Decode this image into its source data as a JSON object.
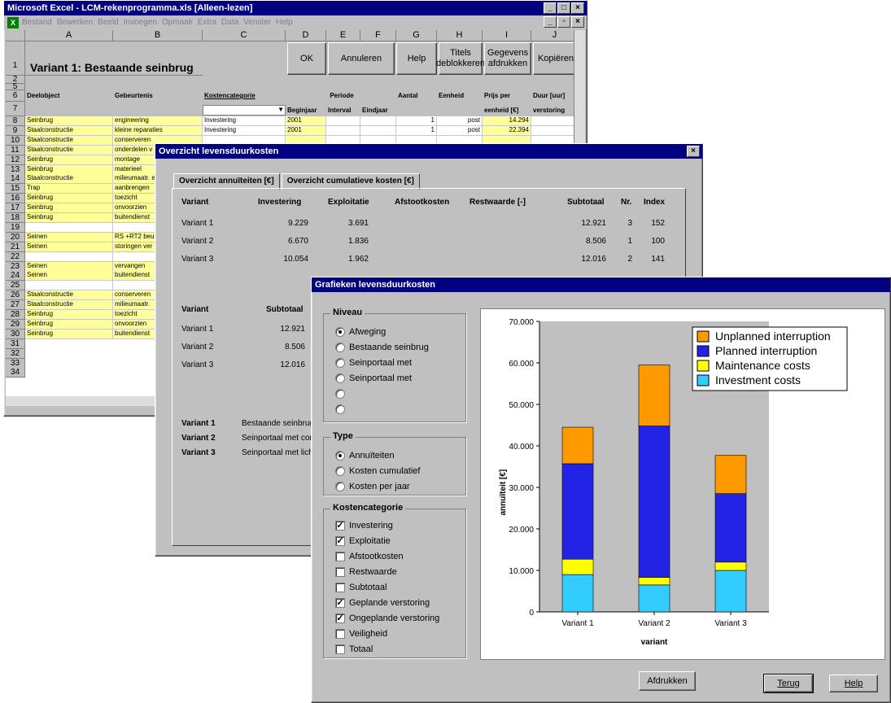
{
  "excel": {
    "title": "Microsoft Excel - LCM-rekenprogramma.xls  [Alleen-lezen]",
    "menu": [
      "Bestand",
      "Bewerken",
      "Beeld",
      "Invoegen",
      "Opmaak",
      "Extra",
      "Data",
      "Venster",
      "Help"
    ],
    "columns": [
      "A",
      "B",
      "C",
      "D",
      "E",
      "F",
      "G",
      "H",
      "I",
      "J"
    ],
    "heading": "Variant 1: Bestaande seinbrug",
    "buttons": {
      "ok": "OK",
      "cancel": "Annuleren",
      "help": "Help",
      "unlock_line1": "Titels",
      "unlock_line2": "deblokkeren",
      "print_line1": "Gegevens",
      "print_line2": "afdrukken",
      "copy": "Kopiëren"
    },
    "row_numbers": [
      "1",
      "2",
      "5",
      "6",
      "7",
      "8",
      "9",
      "10",
      "11",
      "12",
      "13",
      "14",
      "15",
      "16",
      "17",
      "18",
      "19",
      "20",
      "21",
      "22",
      "23",
      "24",
      "25",
      "26",
      "27",
      "28",
      "29",
      "30",
      "31",
      "32",
      "33",
      "34"
    ],
    "headers": {
      "deelobject": "Deelobject",
      "gebeurtenis": "Gebeurtenis",
      "kostencategorie": "Kostencategorie",
      "periode": "Periode",
      "beginjaar": "Beginjaar",
      "interval": "Interval",
      "eindjaar": "Eindjaar",
      "aantal": "Aantal",
      "eenheid": "Eenheid",
      "prijs_per": "Prijs per",
      "eenheid_eur": "eenheid [€]",
      "duur": "Duur [uur]",
      "verstoring": "verstoring"
    },
    "rows": [
      {
        "a": "Seinbrug",
        "b": "engineering",
        "c": "Investering",
        "d": "2001",
        "g": "1",
        "h": "post",
        "i": "14.294"
      },
      {
        "a": "Staalconstructie",
        "b": "kleine reparaties",
        "c": "Investering",
        "d": "2001",
        "g": "1",
        "h": "post",
        "i": "22.394"
      },
      {
        "a": "Staalconstructie",
        "b": "conserveren",
        "c": "",
        "d": "",
        "g": "",
        "h": "",
        "i": ""
      },
      {
        "a": "Staalconstructie",
        "b": "onderdelen v",
        "c": "",
        "d": "",
        "g": "",
        "h": "",
        "i": ""
      },
      {
        "a": "Seinbrug",
        "b": "montage",
        "c": "",
        "d": "",
        "g": "",
        "h": "",
        "i": ""
      },
      {
        "a": "Seinbrug",
        "b": "materieel",
        "c": "",
        "d": "",
        "g": "",
        "h": "",
        "i": ""
      },
      {
        "a": "Staalconstructie",
        "b": "milieumaatr. e",
        "c": "",
        "d": "",
        "g": "",
        "h": "",
        "i": ""
      },
      {
        "a": "Trap",
        "b": "aanbrengen",
        "c": "",
        "d": "",
        "g": "",
        "h": "",
        "i": ""
      },
      {
        "a": "Seinbrug",
        "b": "toezicht",
        "c": "",
        "d": "",
        "g": "",
        "h": "",
        "i": ""
      },
      {
        "a": "Seinbrug",
        "b": "onvoorzien",
        "c": "",
        "d": "",
        "g": "",
        "h": "",
        "i": ""
      },
      {
        "a": "Seinbrug",
        "b": "buitendienst",
        "c": "",
        "d": "",
        "g": "",
        "h": "",
        "i": ""
      },
      {
        "a": "",
        "b": "",
        "c": "",
        "d": "",
        "g": "",
        "h": "",
        "i": ""
      },
      {
        "a": "Seinen",
        "b": "RS +RT2 beu",
        "c": "",
        "d": "",
        "g": "",
        "h": "",
        "i": ""
      },
      {
        "a": "Seinen",
        "b": "storingen ver",
        "c": "",
        "d": "",
        "g": "",
        "h": "",
        "i": ""
      },
      {
        "a": "",
        "b": "",
        "c": "",
        "d": "",
        "g": "",
        "h": "",
        "i": ""
      },
      {
        "a": "Seinen",
        "b": "vervangen",
        "c": "",
        "d": "",
        "g": "",
        "h": "",
        "i": ""
      },
      {
        "a": "Seinen",
        "b": "buitendienst",
        "c": "",
        "d": "",
        "g": "",
        "h": "",
        "i": ""
      },
      {
        "a": "",
        "b": "",
        "c": "",
        "d": "",
        "g": "",
        "h": "",
        "i": ""
      },
      {
        "a": "Staalconstructie",
        "b": "conserveren",
        "c": "",
        "d": "",
        "g": "",
        "h": "",
        "i": ""
      },
      {
        "a": "Staalconstructie",
        "b": "milieumaatr.",
        "c": "",
        "d": "",
        "g": "",
        "h": "",
        "i": ""
      },
      {
        "a": "Seinbrug",
        "b": "toezicht",
        "c": "",
        "d": "",
        "g": "",
        "h": "",
        "i": ""
      },
      {
        "a": "Seinbrug",
        "b": "onvoorzien",
        "c": "",
        "d": "",
        "g": "",
        "h": "",
        "i": ""
      },
      {
        "a": "Seinbrug",
        "b": "buitendienst",
        "c": "",
        "d": "",
        "g": "",
        "h": "",
        "i": ""
      }
    ]
  },
  "overview": {
    "title": "Overzicht levensduurkosten",
    "tabs": [
      "Overzicht annuïteiten [€]",
      "Overzicht cumulatieve kosten [€]"
    ],
    "cols": [
      "Variant",
      "Investering",
      "Exploitatie",
      "Afstootkosten",
      "Restwaarde [-]",
      "Subtotaal",
      "Nr.",
      "Index"
    ],
    "rows": [
      {
        "variant": "Variant 1",
        "investering": "9.229",
        "exploitatie": "3.691",
        "subtotaal": "12.921",
        "nr": "3",
        "index": "152"
      },
      {
        "variant": "Variant 2",
        "investering": "6.670",
        "exploitatie": "1.836",
        "subtotaal": "8.506",
        "nr": "1",
        "index": "100"
      },
      {
        "variant": "Variant 3",
        "investering": "10.054",
        "exploitatie": "1.962",
        "subtotaal": "12.016",
        "nr": "2",
        "index": "141"
      }
    ],
    "cols2": [
      "Variant",
      "Subtotaal"
    ],
    "rows2": [
      {
        "variant": "Variant 1",
        "subtotaal": "12.921"
      },
      {
        "variant": "Variant 2",
        "subtotaal": "8.506"
      },
      {
        "variant": "Variant 3",
        "subtotaal": "12.016"
      }
    ],
    "legend": [
      {
        "variant": "Variant 1",
        "desc": "Bestaande seinbrug"
      },
      {
        "variant": "Variant 2",
        "desc": "Seinportaal met conv"
      },
      {
        "variant": "Variant 3",
        "desc": "Seinportaal met lichtg"
      }
    ]
  },
  "graph": {
    "title": "Grafieken levensduurkosten",
    "niveau_label": "Niveau",
    "niveau": [
      {
        "label": "Afweging",
        "on": true
      },
      {
        "label": "Bestaande seinbrug",
        "on": false
      },
      {
        "label": "Seinportaal met",
        "on": false
      },
      {
        "label": "Seinportaal met",
        "on": false
      },
      {
        "label": "",
        "on": false
      },
      {
        "label": "",
        "on": false
      }
    ],
    "type_label": "Type",
    "type": [
      {
        "label": "Annuïteiten",
        "on": true
      },
      {
        "label": "Kosten cumulatief",
        "on": false
      },
      {
        "label": "Kosten per jaar",
        "on": false
      }
    ],
    "kosten_label": "Kostencategorie",
    "kosten": [
      {
        "label": "Investering",
        "on": true
      },
      {
        "label": "Exploitatie",
        "on": true
      },
      {
        "label": "Afstootkosten",
        "on": false
      },
      {
        "label": "Restwaarde",
        "on": false
      },
      {
        "label": "Subtotaal",
        "on": false
      },
      {
        "label": "Geplande verstoring",
        "on": true
      },
      {
        "label": "Ongeplande verstoring",
        "on": true
      },
      {
        "label": "Veiligheid",
        "on": false
      },
      {
        "label": "Totaal",
        "on": false
      }
    ],
    "buttons": {
      "print": "Afdrukken",
      "back": "Terug",
      "help": "Help"
    }
  },
  "colors": {
    "investment": "#33ccff",
    "maintenance": "#ffff00",
    "planned": "#2323e6",
    "unplanned": "#ff9900"
  },
  "chart_data": {
    "type": "bar",
    "stacked": true,
    "categories": [
      "Variant 1",
      "Variant 2",
      "Variant 3"
    ],
    "series": [
      {
        "name": "Investment costs",
        "color": "#33ccff",
        "values": [
          9000,
          6500,
          10000
        ]
      },
      {
        "name": "Maintenance costs",
        "color": "#ffff00",
        "values": [
          3700,
          1800,
          2000
        ]
      },
      {
        "name": "Planned interruption",
        "color": "#2323e6",
        "values": [
          23000,
          36500,
          16500
        ]
      },
      {
        "name": "Unplanned interruption",
        "color": "#ff9900",
        "values": [
          8800,
          14700,
          9200
        ]
      }
    ],
    "legend_order": [
      "Unplanned interruption",
      "Planned interruption",
      "Maintenance costs",
      "Investment costs"
    ],
    "xlabel": "variant",
    "ylabel": "annuïteit [€]",
    "ylim": [
      0,
      70000
    ],
    "yticks": [
      "0",
      "10.000",
      "20.000",
      "30.000",
      "40.000",
      "50.000",
      "60.000",
      "70.000"
    ],
    "legend_position": "top-right"
  }
}
